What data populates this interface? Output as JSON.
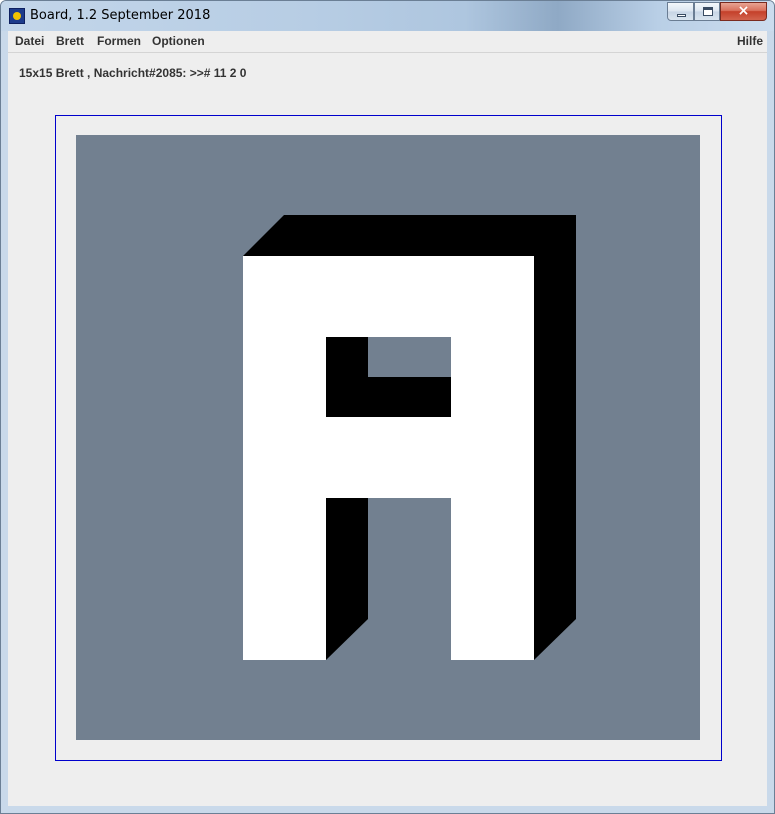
{
  "window": {
    "title": "Board, 1.2 September 2018",
    "icon": "app-icon",
    "controls": {
      "minimize": "minimize-icon",
      "maximize": "maximize-icon",
      "close": "×"
    }
  },
  "menu": {
    "items": [
      "Datei",
      "Brett",
      "Formen",
      "Optionen"
    ],
    "help": "Hilfe"
  },
  "status": {
    "text": "15x15 Brett , Nachricht#2085: >># 11 2 0"
  },
  "board": {
    "size": "15x15",
    "background_color": "#728090",
    "frame_color": "#0000cc",
    "shape": "A",
    "fill_color": "#ffffff",
    "shadow_color": "#000000"
  }
}
